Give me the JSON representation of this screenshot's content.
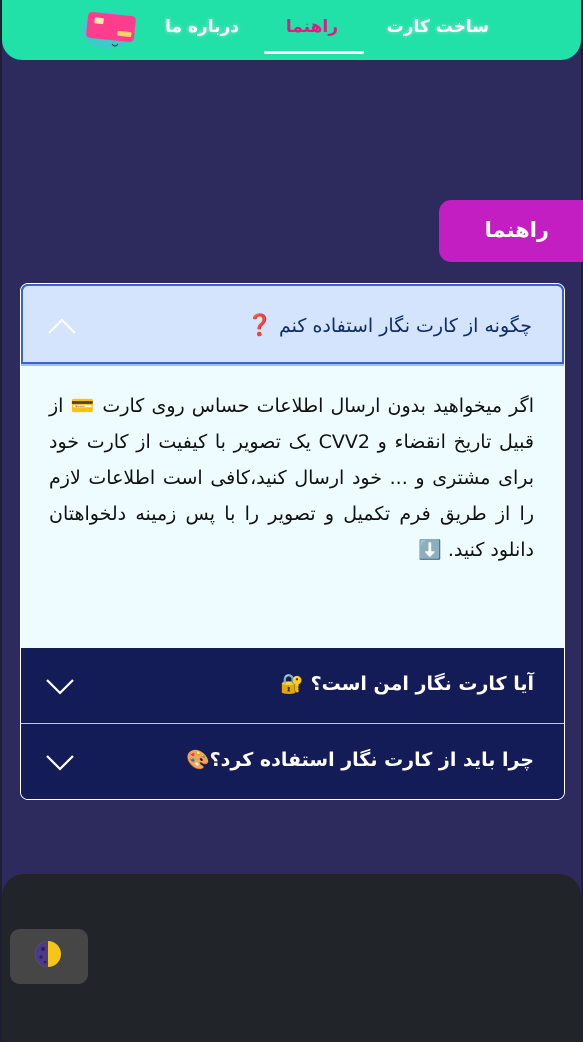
{
  "nav": {
    "build_card": "ساخت کارت",
    "guide": "راهنما",
    "about": "درباره ما"
  },
  "section_tab": "راهنما",
  "accordion": [
    {
      "title": "چگونه از کارت نگار استفاده کنم",
      "title_emoji": "❓",
      "expanded": true,
      "body": "اگر میخواهید بدون ارسال اطلاعات حساس روی کارت 💳 از قبیل تاریخ انقضاء و CVV2 یک تصویر با کیفیت از کارت خود برای مشتری و ... خود ارسال کنید،کافی است اطلاعات لازم را از طریق فرم تکمیل و تصویر را با پس زمینه دلخواهتان دانلود کنید. ⬇️"
    },
    {
      "title": "آیا کارت نگار امن است؟",
      "title_emoji": "🔐",
      "expanded": false
    },
    {
      "title": "چرا باید از کارت نگار استفاده کرد؟",
      "title_emoji": "🎨",
      "expanded": false
    }
  ],
  "colors": {
    "navbar": "#21e0a8",
    "background": "#2d2b5e",
    "section_tab": "#c21ec2",
    "accordion_dark": "#141c58",
    "footer": "#212529"
  },
  "icons": [
    "logo-card-icon",
    "chevron-up-icon",
    "chevron-down-icon",
    "theme-toggle-icon"
  ]
}
